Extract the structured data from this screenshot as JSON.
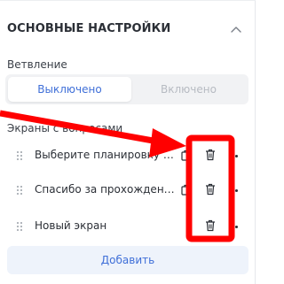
{
  "header": {
    "title": "ОСНОВНЫЕ НАСТРОЙКИ",
    "chevron_icon": "chevron-up-icon"
  },
  "branching": {
    "label": "Ветвление",
    "options": [
      "Выключено",
      "Включено"
    ],
    "selected": "Выключено"
  },
  "screens": {
    "label": "Экраны с вопросами",
    "items": [
      {
        "title": "Выберите планировку ва..."
      },
      {
        "title": "Спасибо за прохождение..."
      },
      {
        "title": "Новый экран"
      }
    ]
  },
  "add_button": {
    "label": "Добавить"
  },
  "colors": {
    "accent": "#3f6fd8",
    "annotation": "#ff0000"
  }
}
